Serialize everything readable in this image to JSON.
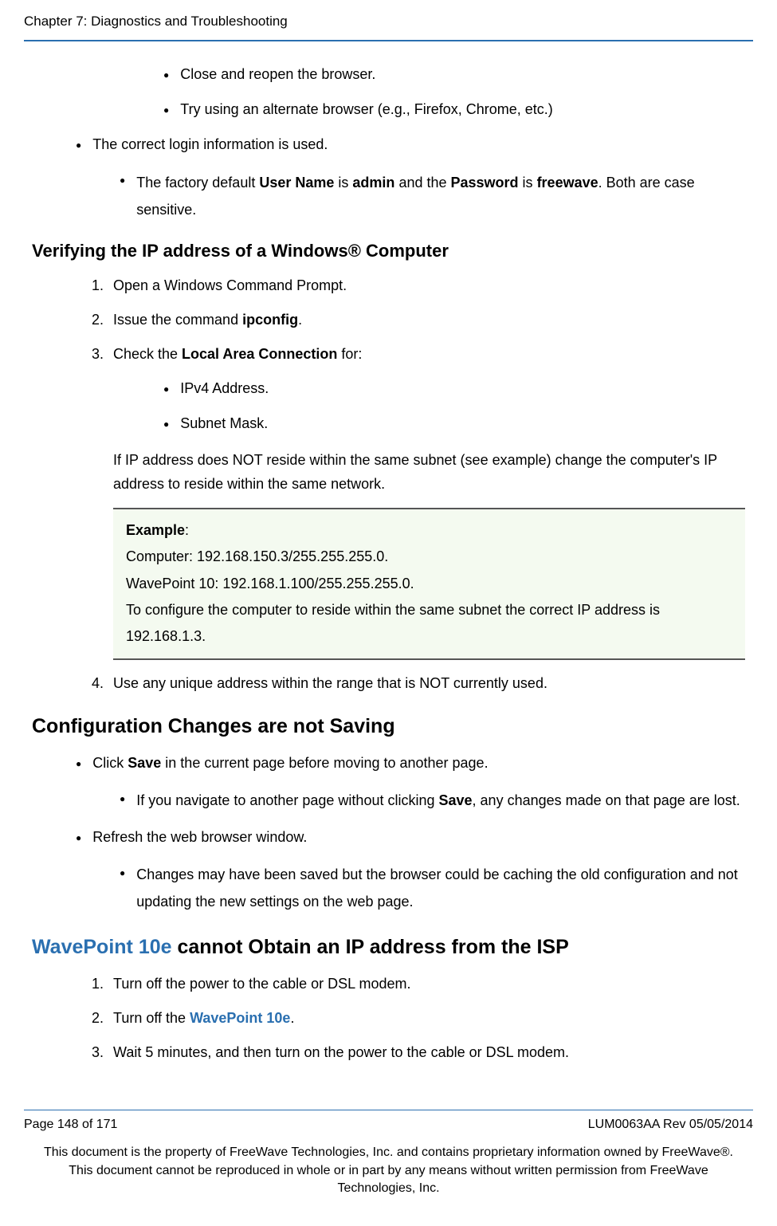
{
  "header": {
    "chapter": "Chapter 7: Diagnostics and Troubleshooting"
  },
  "intro": {
    "l3_a": "Close and reopen the browser.",
    "l3_b": "Try using an alternate browser (e.g., Firefox, Chrome, etc.)",
    "l1_a": "The correct login information is used.",
    "l2_a_pre": "The factory default ",
    "l2_a_b1": "User Name",
    "l2_a_mid1": " is ",
    "l2_a_b2": "admin",
    "l2_a_mid2": " and the ",
    "l2_a_b3": "Password",
    "l2_a_mid3": " is ",
    "l2_a_b4": "freewave",
    "l2_a_end": ". Both are case sensitive."
  },
  "sec1": {
    "title": "Verifying the IP address of a Windows® Computer",
    "i1": "Open a Windows Command Prompt.",
    "i2_pre": "Issue the command ",
    "i2_b": "ipconfig",
    "i2_end": ".",
    "i3_pre": "Check the ",
    "i3_b": "Local Area Connection",
    "i3_end": " for:",
    "i3_sub_a": "IPv4 Address.",
    "i3_sub_b": "Subnet Mask.",
    "i3_note": "If IP address does NOT reside within the same subnet (see example) change the computer's IP address to reside within the same network.",
    "example": {
      "label": "Example",
      "l1": "Computer: 192.168.150.3/255.255.255.0.",
      "l2": "WavePoint 10: 192.168.1.100/255.255.255.0.",
      "l3": "To configure the computer to reside within the same subnet the correct IP address is 192.168.1.3."
    },
    "i4": "Use any unique address within the range that is NOT currently used."
  },
  "sec2": {
    "title": "Configuration Changes are not Saving",
    "b1_pre": "Click ",
    "b1_b": "Save",
    "b1_end": " in the current page before moving to another page.",
    "b1_sub_pre": "If you navigate to another page without clicking ",
    "b1_sub_b": "Save",
    "b1_sub_end": ", any changes made on that page are lost.",
    "b2": "Refresh the web browser window.",
    "b2_sub": "Changes may have been saved but the browser could be caching the old configuration and not updating the new settings on the web page."
  },
  "sec3": {
    "title_blue": "WavePoint 10e",
    "title_rest": " cannot Obtain an IP address from the ISP",
    "i1": "Turn off the power to the cable or DSL modem.",
    "i2_pre": "Turn off the ",
    "i2_blue": "WavePoint 10e",
    "i2_end": ".",
    "i3": "Wait 5 minutes, and then turn on the power to the cable or DSL modem."
  },
  "footer": {
    "page": "Page 148 of 171",
    "rev": "LUM0063AA Rev 05/05/2014",
    "disclaimer": "This document is the property of FreeWave Technologies, Inc. and contains proprietary information owned by FreeWave®. This document cannot be reproduced in whole or in part by any means without written permission from FreeWave Technologies, Inc."
  }
}
